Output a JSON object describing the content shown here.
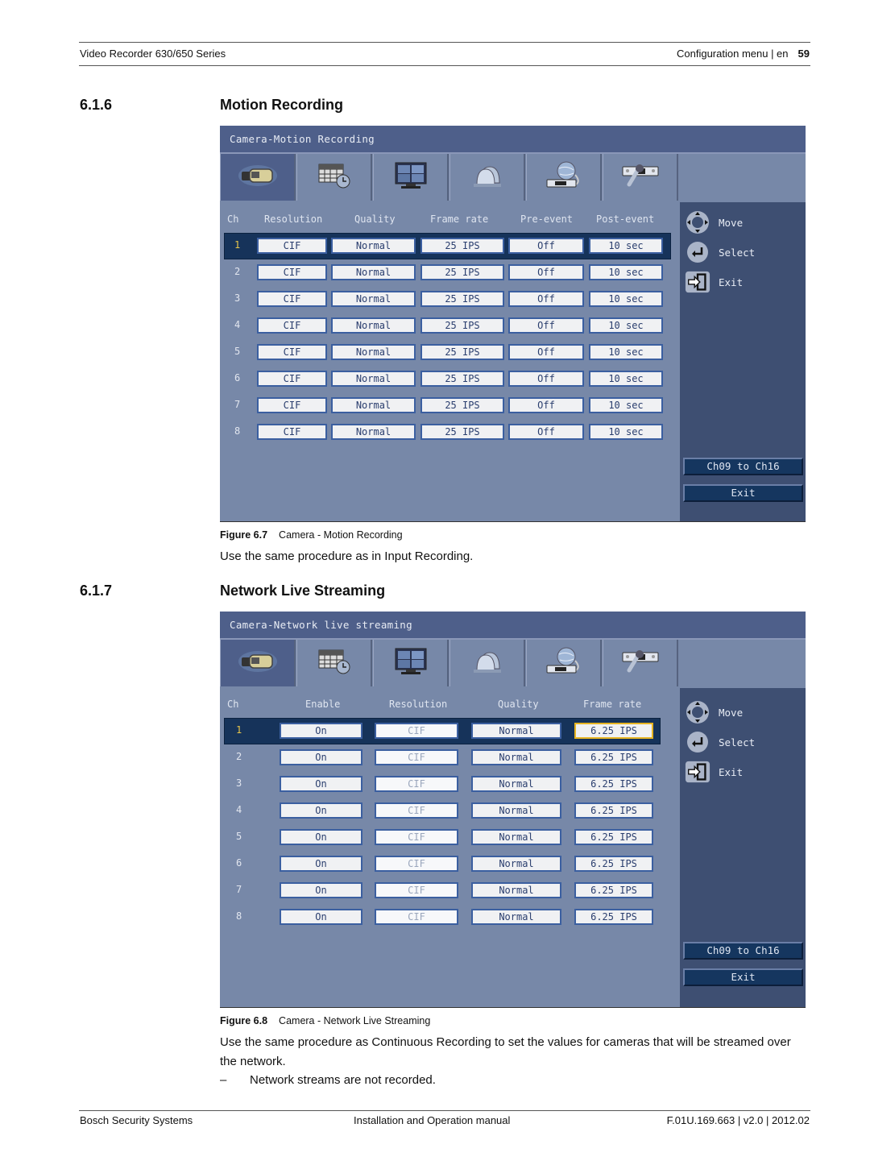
{
  "header": {
    "left": "Video Recorder 630/650 Series",
    "right": "Configuration menu | en",
    "page_number": "59"
  },
  "section_616": {
    "number": "6.1.6",
    "title": "Motion Recording",
    "panel": {
      "title": "Camera-Motion Recording",
      "tabs": [
        {
          "icon": "camera-icon",
          "active": true
        },
        {
          "icon": "schedule-icon",
          "active": false
        },
        {
          "icon": "monitor-icon",
          "active": false
        },
        {
          "icon": "alarm-icon",
          "active": false
        },
        {
          "icon": "network-icon",
          "active": false
        },
        {
          "icon": "system-tools-icon",
          "active": false
        }
      ],
      "columns": [
        "Ch",
        "Resolution",
        "Quality",
        "Frame rate",
        "Pre-event",
        "Post-event"
      ],
      "selected_row": 1,
      "rows": [
        {
          "ch": "1",
          "resolution": "CIF",
          "quality": "Normal",
          "frame_rate": "25 IPS",
          "pre_event": "Off",
          "post_event": "10 sec"
        },
        {
          "ch": "2",
          "resolution": "CIF",
          "quality": "Normal",
          "frame_rate": "25 IPS",
          "pre_event": "Off",
          "post_event": "10 sec"
        },
        {
          "ch": "3",
          "resolution": "CIF",
          "quality": "Normal",
          "frame_rate": "25 IPS",
          "pre_event": "Off",
          "post_event": "10 sec"
        },
        {
          "ch": "4",
          "resolution": "CIF",
          "quality": "Normal",
          "frame_rate": "25 IPS",
          "pre_event": "Off",
          "post_event": "10 sec"
        },
        {
          "ch": "5",
          "resolution": "CIF",
          "quality": "Normal",
          "frame_rate": "25 IPS",
          "pre_event": "Off",
          "post_event": "10 sec"
        },
        {
          "ch": "6",
          "resolution": "CIF",
          "quality": "Normal",
          "frame_rate": "25 IPS",
          "pre_event": "Off",
          "post_event": "10 sec"
        },
        {
          "ch": "7",
          "resolution": "CIF",
          "quality": "Normal",
          "frame_rate": "25 IPS",
          "pre_event": "Off",
          "post_event": "10 sec"
        },
        {
          "ch": "8",
          "resolution": "CIF",
          "quality": "Normal",
          "frame_rate": "25 IPS",
          "pre_event": "Off",
          "post_event": "10 sec"
        }
      ],
      "legend": {
        "move": "Move",
        "select": "Select",
        "exit": "Exit"
      },
      "buttons": {
        "next_channels": "Ch09 to Ch16",
        "exit": "Exit"
      }
    },
    "figure_label": "Figure 6.7",
    "figure_caption": "Camera - Motion Recording",
    "paragraph": "Use the same procedure as in Input Recording."
  },
  "section_617": {
    "number": "6.1.7",
    "title": "Network Live Streaming",
    "panel": {
      "title": "Camera-Network live streaming",
      "tabs": [
        {
          "icon": "camera-icon",
          "active": true
        },
        {
          "icon": "schedule-icon",
          "active": false
        },
        {
          "icon": "monitor-icon",
          "active": false
        },
        {
          "icon": "alarm-icon",
          "active": false
        },
        {
          "icon": "network-icon",
          "active": false
        },
        {
          "icon": "system-tools-icon",
          "active": false
        }
      ],
      "columns": [
        "Ch",
        "Enable",
        "Resolution",
        "Quality",
        "Frame rate"
      ],
      "selected_row": 1,
      "focused_cell": "frame_rate",
      "rows": [
        {
          "ch": "1",
          "enable": "On",
          "resolution": "CIF",
          "quality": "Normal",
          "frame_rate": "6.25 IPS"
        },
        {
          "ch": "2",
          "enable": "On",
          "resolution": "CIF",
          "quality": "Normal",
          "frame_rate": "6.25 IPS"
        },
        {
          "ch": "3",
          "enable": "On",
          "resolution": "CIF",
          "quality": "Normal",
          "frame_rate": "6.25 IPS"
        },
        {
          "ch": "4",
          "enable": "On",
          "resolution": "CIF",
          "quality": "Normal",
          "frame_rate": "6.25 IPS"
        },
        {
          "ch": "5",
          "enable": "On",
          "resolution": "CIF",
          "quality": "Normal",
          "frame_rate": "6.25 IPS"
        },
        {
          "ch": "6",
          "enable": "On",
          "resolution": "CIF",
          "quality": "Normal",
          "frame_rate": "6.25 IPS"
        },
        {
          "ch": "7",
          "enable": "On",
          "resolution": "CIF",
          "quality": "Normal",
          "frame_rate": "6.25 IPS"
        },
        {
          "ch": "8",
          "enable": "On",
          "resolution": "CIF",
          "quality": "Normal",
          "frame_rate": "6.25 IPS"
        }
      ],
      "legend": {
        "move": "Move",
        "select": "Select",
        "exit": "Exit"
      },
      "buttons": {
        "next_channels": "Ch09 to Ch16",
        "exit": "Exit"
      }
    },
    "figure_label": "Figure 6.8",
    "figure_caption": "Camera - Network Live Streaming",
    "paragraph": "Use the same procedure as Continuous Recording to set the values for cameras that will be streamed over the network.",
    "bullet_dash": "–",
    "bullet": "Network streams are not recorded."
  },
  "footer": {
    "left": "Bosch Security Systems",
    "center": "Installation and Operation manual",
    "right": "F.01U.169.663 | v2.0 | 2012.02"
  },
  "colors": {
    "panel_bg": "#7788a8",
    "title_bar": "#4e5f8a",
    "sidebar": "#3e4f72",
    "selected_row": "#16335a",
    "selected_ch_text": "#e8c64a",
    "focus_border": "#e6b422",
    "cell_border": "#3b5fa0"
  }
}
